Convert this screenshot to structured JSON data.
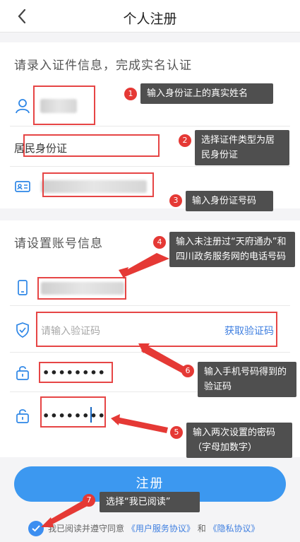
{
  "header": {
    "title": "个人注册"
  },
  "section1": {
    "title": "请录入证件信息，完成实名认证",
    "doc_type_value": "居民身份证"
  },
  "section2": {
    "title": "请设置账号信息",
    "code_placeholder": "请输入验证码",
    "get_code_label": "获取验证码",
    "password_mask": "••••••••",
    "password_confirm_mask": "••••••••"
  },
  "register_button": "注册",
  "agreement": {
    "prefix": "我已阅读并遵守同意",
    "user_agreement": "《用户服务协议》",
    "and": "和",
    "privacy": "《隐私协议》"
  },
  "annotations": [
    {
      "num": "1",
      "text": "输入身份证上的真实姓名"
    },
    {
      "num": "2",
      "text": "选择证件类型为居民身份证"
    },
    {
      "num": "3",
      "text": "输入身份证号码"
    },
    {
      "num": "4",
      "text": "输入未注册过“天府通办”和四川政务服务网的电话号码"
    },
    {
      "num": "5",
      "text": "输入两次设置的密码（字母加数字）"
    },
    {
      "num": "6",
      "text": "输入手机号码得到的验证码"
    },
    {
      "num": "7",
      "text": "选择“我已阅读”"
    }
  ],
  "colors": {
    "accent": "#3c98f0",
    "annotation_red": "#e53935",
    "note_bg": "#4f4f4f"
  }
}
